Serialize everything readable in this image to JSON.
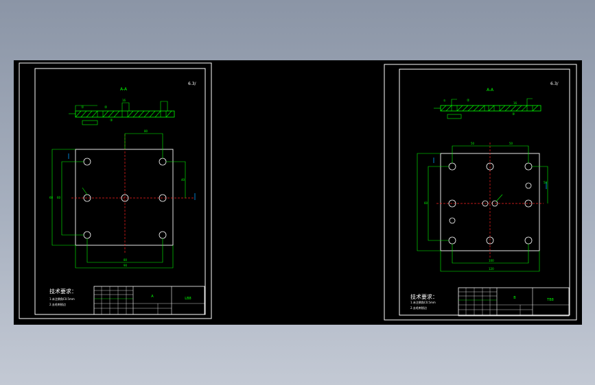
{
  "drawing_left": {
    "view_label": "A-A",
    "roughness_mark": "6.3/",
    "tech_title": "技术要求：",
    "tech_line1": "1.未注倒角C0.5mm",
    "tech_line2": "2.去毛刺锐边",
    "part_name": "A",
    "drawing_no": "LB8",
    "section_tags": [
      "①",
      "②",
      "③",
      "16"
    ],
    "dims": [
      "80",
      "60",
      "60",
      "40",
      "80",
      "90"
    ]
  },
  "drawing_right": {
    "view_label": "A-A",
    "roughness_mark": "6.3/",
    "tech_title": "技术要求：",
    "tech_line1": "1.未注倒角C0.5mm",
    "tech_line2": "2.去毛刺锐边",
    "part_name": "B",
    "drawing_no": "TB8",
    "section_tags": [
      "①",
      "②",
      "③",
      "16"
    ],
    "dims": [
      "50",
      "50",
      "50",
      "60",
      "100",
      "120"
    ]
  },
  "colors": {
    "line": "#00ff00",
    "frame": "#ffffff",
    "hole": "#ff4040",
    "centerline": "#ff2020",
    "background": "#000000",
    "arrow": "#00a0ff"
  }
}
